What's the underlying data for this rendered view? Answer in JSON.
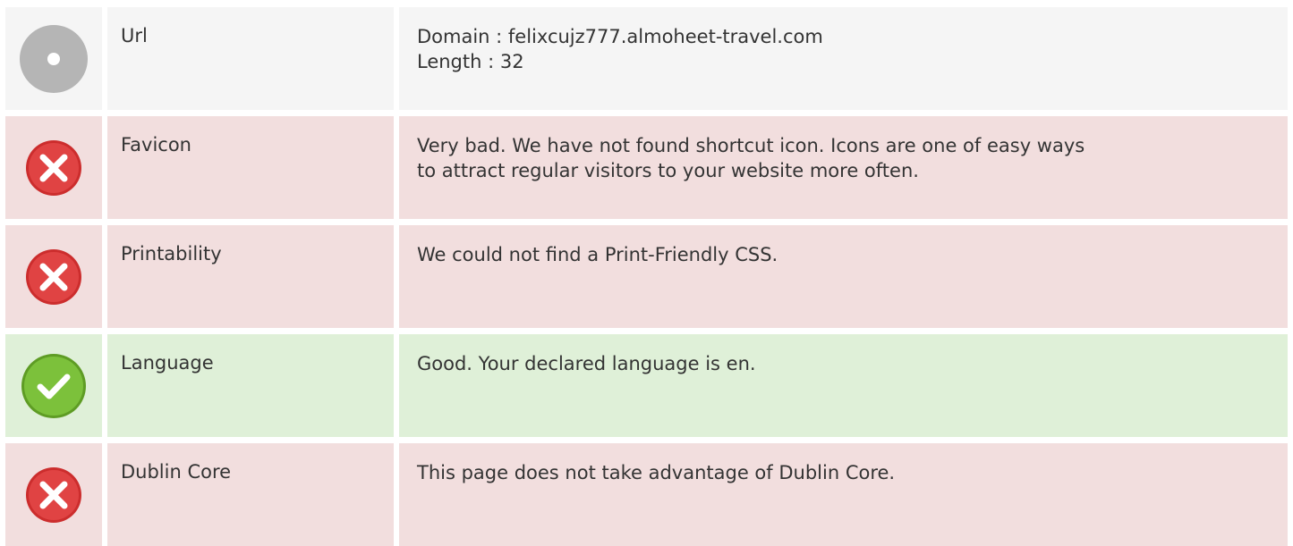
{
  "rows": [
    {
      "status": "neutral",
      "icon": "neutral-dot-icon",
      "label": "Url",
      "lines": [
        "Domain : felixcujz777.almoheet-travel.com",
        "Length : 32"
      ]
    },
    {
      "status": "bad",
      "icon": "error-x-icon",
      "label": "Favicon",
      "lines": [
        "Very bad. We have not found shortcut icon. Icons are one of easy ways",
        "to attract regular visitors to your website more often."
      ]
    },
    {
      "status": "bad",
      "icon": "error-x-icon",
      "label": "Printability",
      "lines": [
        "We could not find a Print-Friendly CSS."
      ]
    },
    {
      "status": "good",
      "icon": "check-icon",
      "label": "Language",
      "lines": [
        "Good. Your declared language is en."
      ]
    },
    {
      "status": "bad",
      "icon": "error-x-icon",
      "label": "Dublin Core",
      "lines": [
        "This page does not take advantage of Dublin Core."
      ]
    }
  ],
  "colors": {
    "neutral_bg": "#f5f5f5",
    "bad_bg": "#f2dede",
    "good_bg": "#dff0d8",
    "bad_icon": "#e04343",
    "good_icon": "#7cc13b",
    "neutral_icon": "#b5b5b5"
  }
}
